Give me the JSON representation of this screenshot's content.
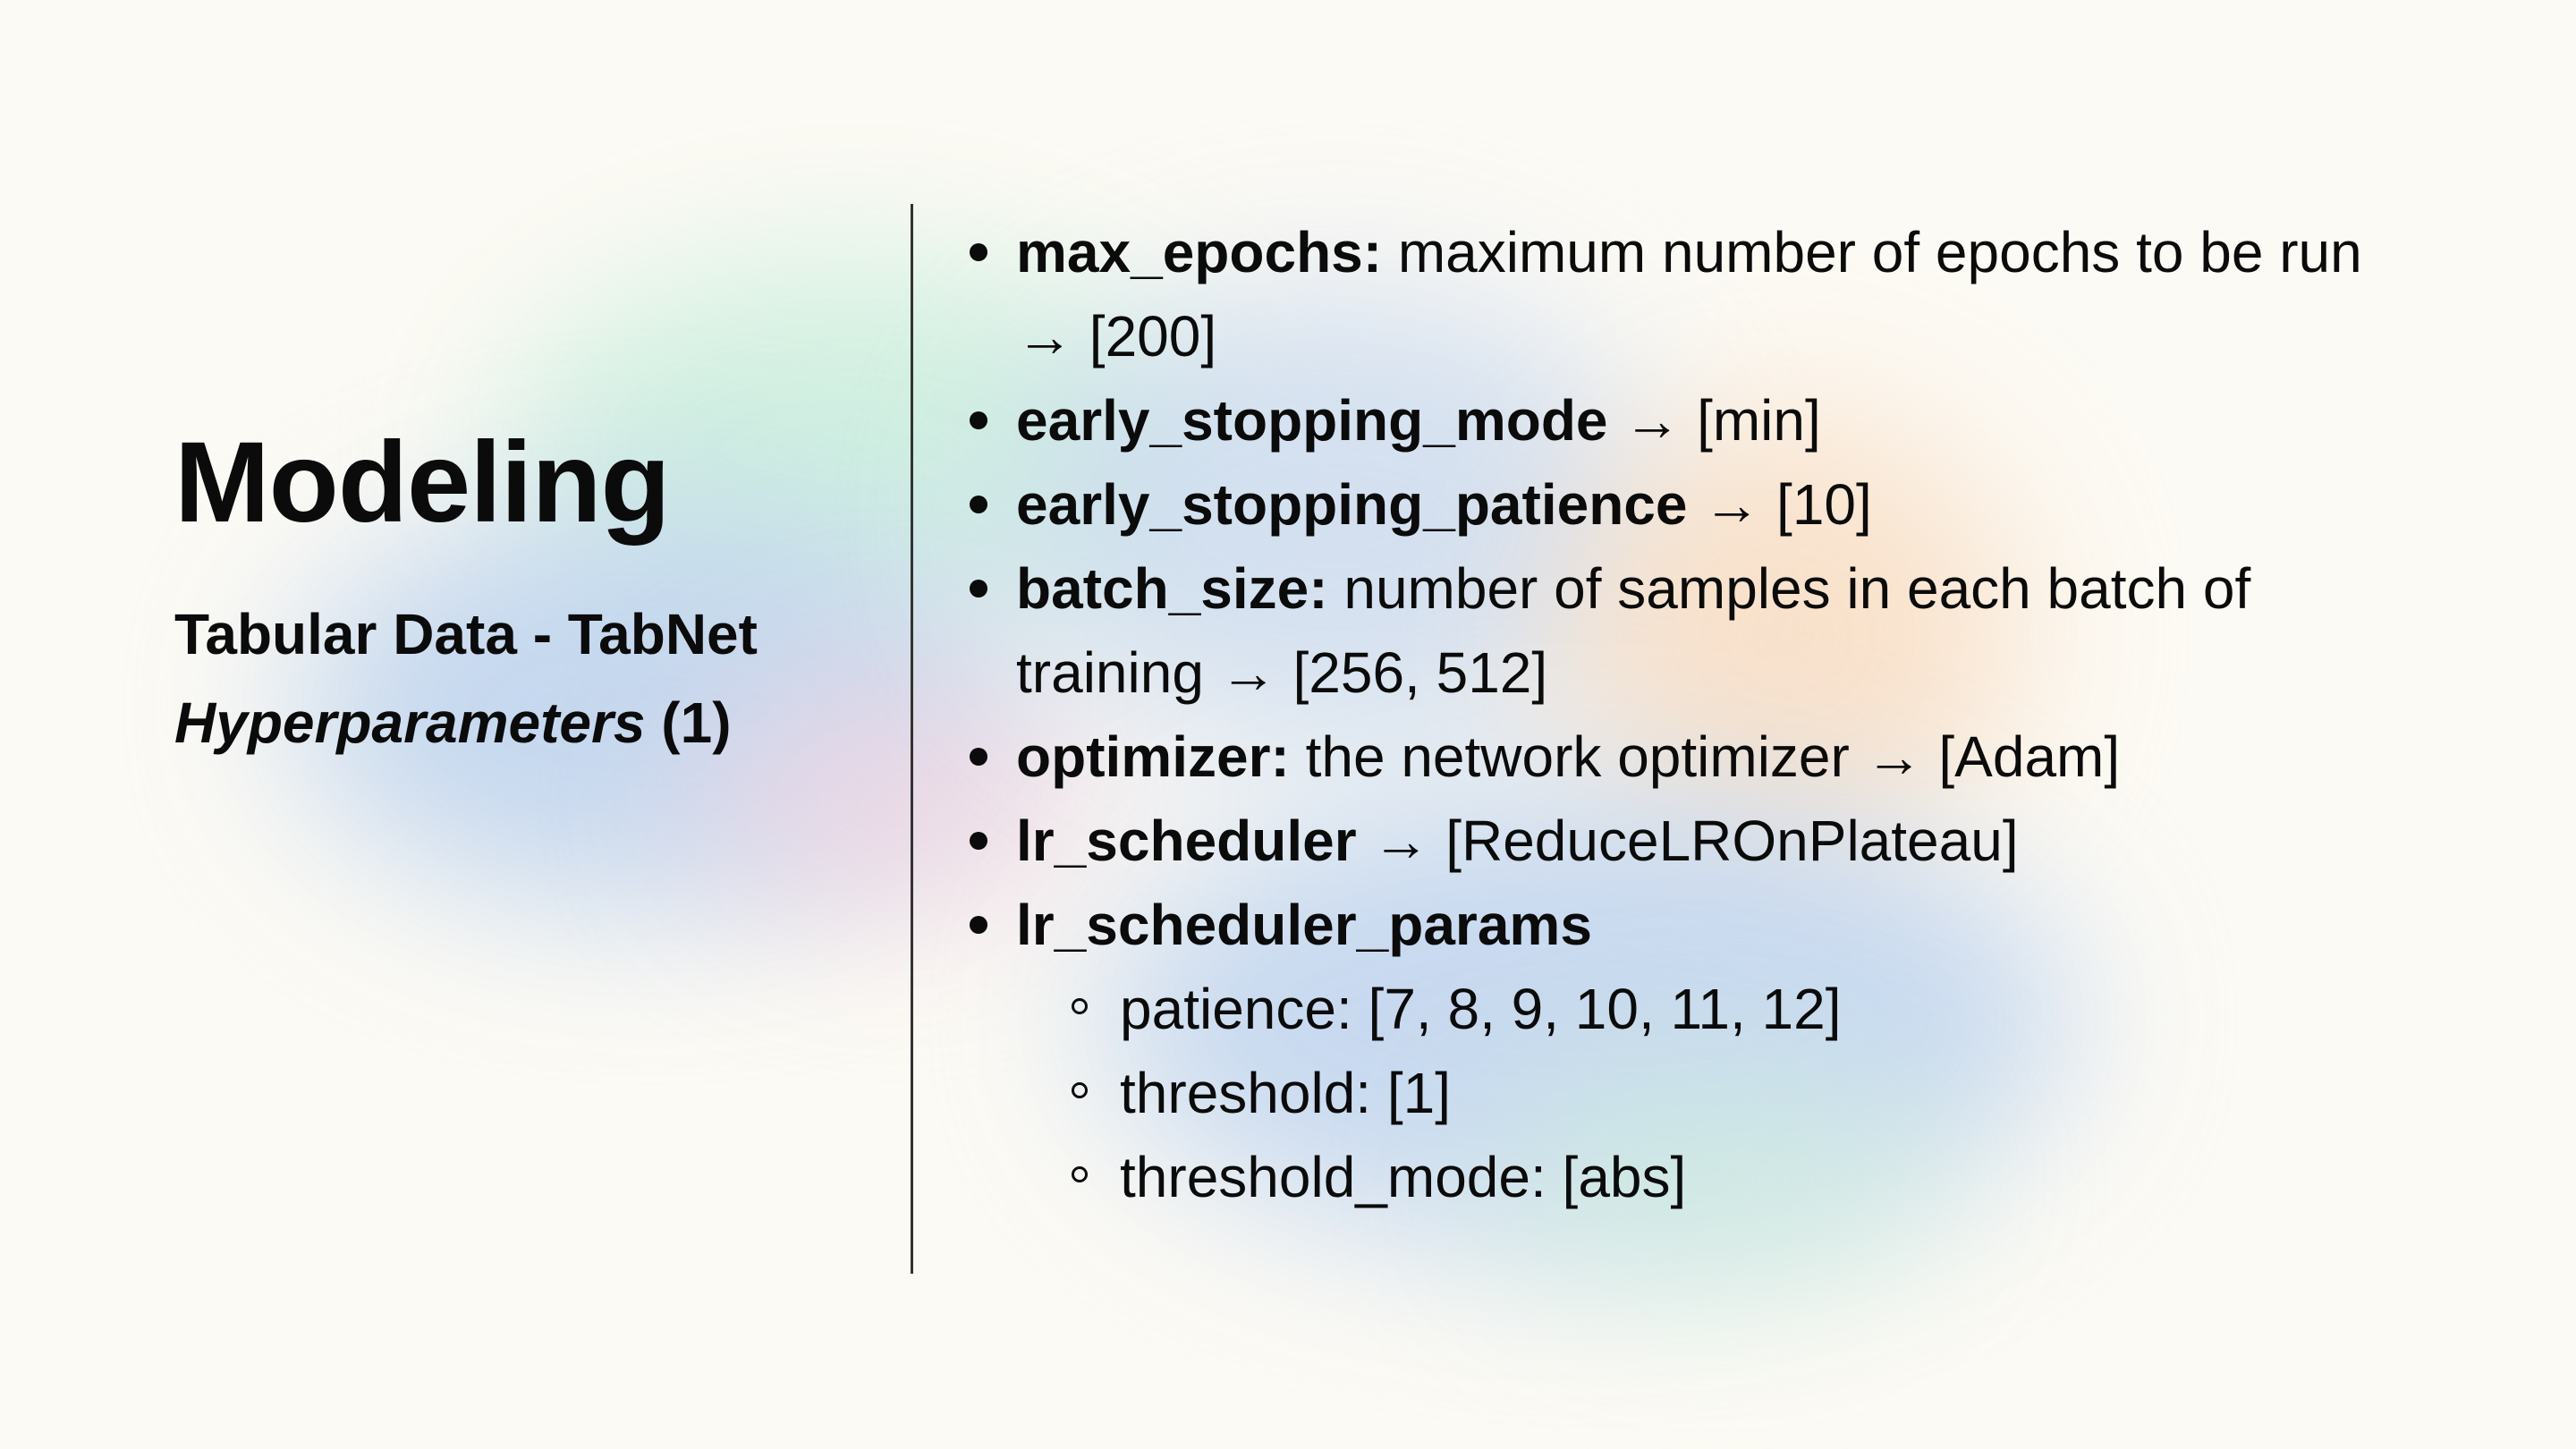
{
  "left": {
    "title": "Modeling",
    "subtitle": "Tabular Data - TabNet",
    "subtitle2_italic": "Hyperparameters",
    "subtitle2_rest": " (1)"
  },
  "items": [
    {
      "key": "max_epochs:",
      "rest": " maximum number of epochs to be run",
      "rest2": "→ [200]"
    },
    {
      "key": "early_stopping_mode",
      "rest": " → [min]"
    },
    {
      "key": "early_stopping_patience",
      "rest": " → [10]"
    },
    {
      "key": "batch_size:",
      "rest": " number of samples in each batch of",
      "rest2": "training → [256, 512]"
    },
    {
      "key": "optimizer:",
      "rest": " the network optimizer → [Adam]"
    },
    {
      "key": "lr_scheduler",
      "rest": " → [ReduceLROnPlateau]"
    },
    {
      "key": "lr_scheduler_params",
      "rest": ""
    }
  ],
  "subitems": [
    "patience: [7, 8, 9, 10, 11, 12]",
    "threshold: [1]",
    "threshold_mode: [abs]"
  ]
}
